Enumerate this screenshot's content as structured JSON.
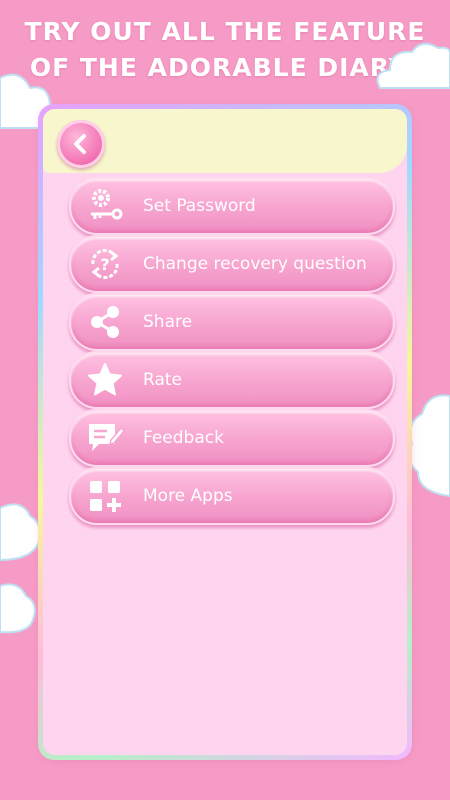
{
  "headline": {
    "line1": "TRY OUT ALL THE FEATURE",
    "line2": "OF THE ADORABLE DIARY!"
  },
  "colors": {
    "background": "#f69bc6",
    "panel": "#ffd4ef",
    "header": "#f7f6cc",
    "button": "#f7a6d0",
    "text": "#ffffff"
  },
  "back_button": {
    "icon": "chevron-left-icon"
  },
  "menu": {
    "items": [
      {
        "label": "Set Password",
        "icon": "gear-key-icon"
      },
      {
        "label": "Change recovery question",
        "icon": "question-refresh-icon"
      },
      {
        "label": "Share",
        "icon": "share-icon"
      },
      {
        "label": "Rate",
        "icon": "star-icon"
      },
      {
        "label": "Feedback",
        "icon": "feedback-icon"
      },
      {
        "label": "More Apps",
        "icon": "more-apps-icon"
      }
    ]
  }
}
